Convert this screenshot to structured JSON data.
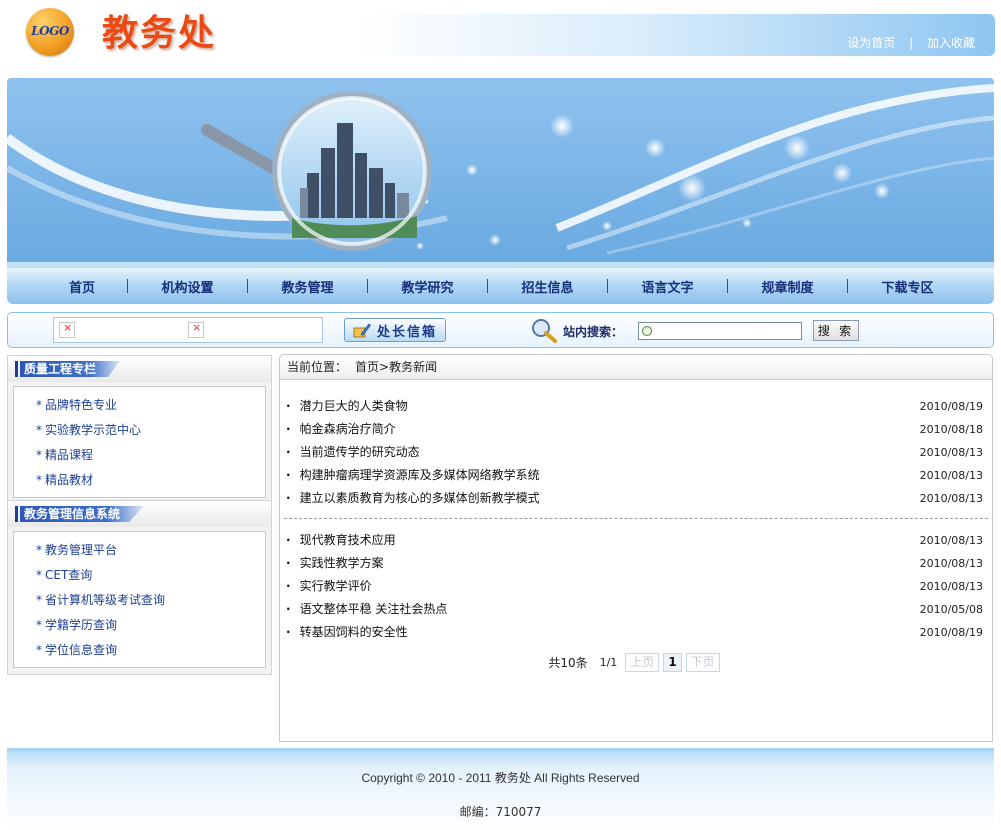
{
  "header": {
    "logo_text": "LOGO",
    "site_title": "教务处",
    "links": [
      "设为首页",
      "加入收藏"
    ],
    "link_separator": "|"
  },
  "nav": {
    "items": [
      "首页",
      "机构设置",
      "教务管理",
      "教学研究",
      "招生信息",
      "语言文字",
      "规章制度",
      "下载专区"
    ]
  },
  "searchbar": {
    "mailbox_label": "处长信箱",
    "search_label": "站内搜索：",
    "search_value": "",
    "search_button": "搜 索"
  },
  "sidebar": {
    "boxes": [
      {
        "title": "质量工程专栏",
        "items": [
          "品牌特色专业",
          "实验教学示范中心",
          "精品课程",
          "精品教材"
        ]
      },
      {
        "title": "教务管理信息系统",
        "items": [
          "教务管理平台",
          "CET查询",
          "省计算机等级考试查询",
          "学籍学历查询",
          "学位信息查询"
        ]
      }
    ],
    "bullet": "*"
  },
  "main": {
    "crumb_label": "当前位置：",
    "crumb_path": "首页>教务新闻",
    "news_groups": [
      [
        {
          "title": "潜力巨大的人类食物",
          "date": "2010/08/19"
        },
        {
          "title": "帕金森病治疗简介",
          "date": "2010/08/18"
        },
        {
          "title": "当前遗传学的研究动态",
          "date": "2010/08/13"
        },
        {
          "title": "构建肿瘤病理学资源库及多媒体网络教学系统",
          "date": "2010/08/13"
        },
        {
          "title": "建立以素质教育为核心的多媒体创新教学模式",
          "date": "2010/08/13"
        }
      ],
      [
        {
          "title": "现代教育技术应用",
          "date": "2010/08/13"
        },
        {
          "title": "实践性教学方案",
          "date": "2010/08/13"
        },
        {
          "title": "实行教学评价",
          "date": "2010/08/13"
        },
        {
          "title": "语文整体平稳 关注社会热点",
          "date": "2010/05/08"
        },
        {
          "title": "转基因饲料的安全性",
          "date": "2010/08/19"
        }
      ]
    ],
    "pager": {
      "count": "共10条",
      "pages": "1/1",
      "prev": "上页",
      "current": "1",
      "next": "下页"
    }
  },
  "footer": {
    "copyright": "Copyright © 2010 - 2011 教务处  All Rights Reserved",
    "zip": "邮编：710077"
  },
  "colors": {
    "title_orange": "#ea4a14",
    "nav_text": "#1a2f7a",
    "link_blue": "#1c3f94",
    "banner_blue": "#7db6e8"
  }
}
